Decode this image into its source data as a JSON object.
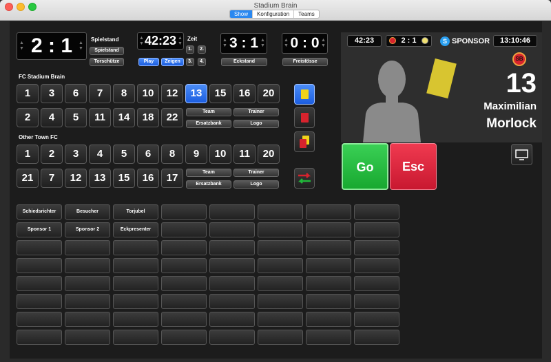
{
  "window": {
    "title": "Stadium Brain"
  },
  "tabs": [
    {
      "label": "Show",
      "active": true
    },
    {
      "label": "Konfiguration",
      "active": false
    },
    {
      "label": "Teams",
      "active": false
    }
  ],
  "score_panel": {
    "score": "2 : 1",
    "title": "Spielstand",
    "spielstand_button": "Spielstand",
    "torschuetze_button": "Torschütze"
  },
  "time_panel": {
    "time": "42:23",
    "title": "Zeit",
    "play_button": "Play",
    "zeigen_button": "Zeigen",
    "halves": [
      "1.",
      "2.",
      "3.",
      "4."
    ]
  },
  "corners_panel": {
    "value": "3 : 1",
    "button": "Eckstand"
  },
  "freekicks_panel": {
    "value": "0 : 0",
    "button": "Freistösse"
  },
  "team_home": {
    "name": "FC Stadium Brain",
    "row1": [
      "1",
      "3",
      "6",
      "7",
      "8",
      "10",
      "12",
      "13",
      "15",
      "16",
      "20"
    ],
    "row2": [
      "2",
      "4",
      "5",
      "11",
      "14",
      "18",
      "22"
    ],
    "selected": "13",
    "buttons": {
      "team": "Team",
      "trainer": "Trainer",
      "bench": "Ersatzbank",
      "logo": "Logo"
    }
  },
  "team_away": {
    "name": "Other Town FC",
    "row1": [
      "1",
      "2",
      "3",
      "4",
      "5",
      "6",
      "8",
      "9",
      "10",
      "11",
      "20"
    ],
    "row2": [
      "21",
      "7",
      "12",
      "13",
      "15",
      "16",
      "17"
    ],
    "buttons": {
      "team": "Team",
      "trainer": "Trainer",
      "bench": "Ersatzbank",
      "logo": "Logo"
    }
  },
  "cards": {
    "yellow": "#f0d21a",
    "red": "#d7232d",
    "accent": "#2a6ef0"
  },
  "preview": {
    "time": "42:23",
    "score": "2 : 1",
    "sponsor": "SPONSOR",
    "clock": "13:10:46",
    "badge": "SB",
    "number": "13",
    "first_name": "Maximilian",
    "last_name": "Morlock"
  },
  "actions": {
    "go": "Go",
    "esc": "Esc",
    "go_color": "#20b83a",
    "esc_color": "#d8213a"
  },
  "grid": {
    "row1": [
      "Schiedsrichter",
      "Besucher",
      "Torjubel",
      "",
      "",
      "",
      "",
      ""
    ],
    "row2": [
      "Sponsor 1",
      "Sponsor 2",
      "Eckpresenter",
      "",
      "",
      "",
      "",
      ""
    ]
  }
}
